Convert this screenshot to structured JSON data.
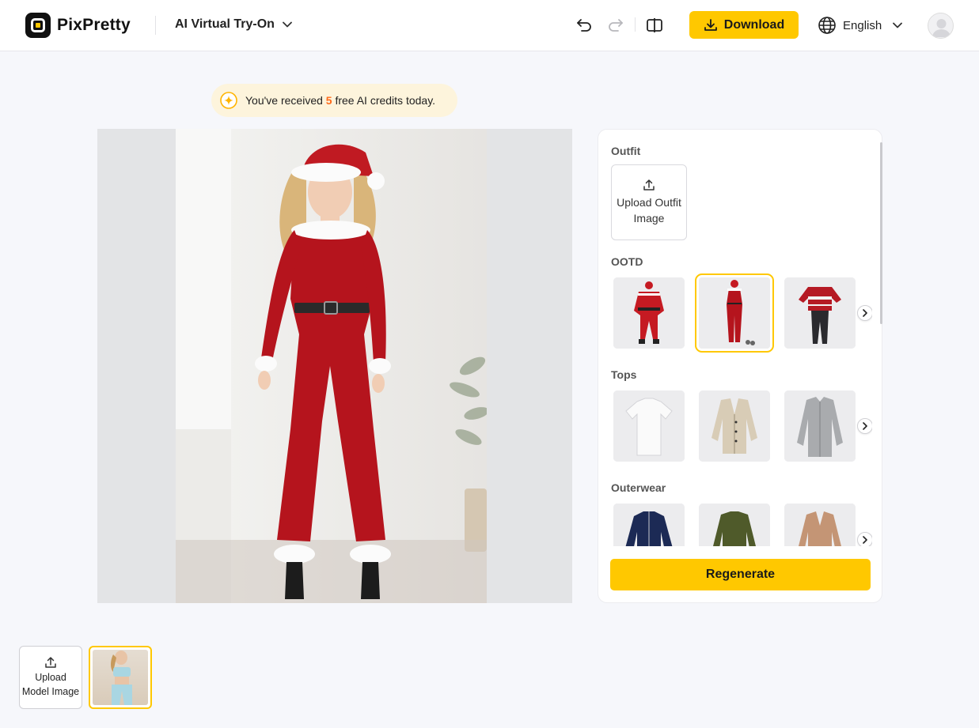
{
  "header": {
    "brand": "PixPretty",
    "tool_name": "AI Virtual Try-On",
    "download_label": "Download",
    "language": "English"
  },
  "banner": {
    "prefix": "You've received",
    "count": "5",
    "suffix": "free AI credits today."
  },
  "panel": {
    "outfit_title": "Outfit",
    "upload_outfit_label": "Upload Outfit Image",
    "sections": [
      {
        "title": "OOTD",
        "items": [
          "santa-suit",
          "red-jumpsuit",
          "christmas-sweater"
        ],
        "selected_index": 1
      },
      {
        "title": "Tops",
        "items": [
          "white-tshirt",
          "beige-cardigan",
          "grey-shirt"
        ]
      },
      {
        "title": "Outerwear",
        "items": [
          "navy-jacket",
          "olive-coat",
          "camel-blazer"
        ]
      }
    ],
    "regenerate_label": "Regenerate"
  },
  "bottom": {
    "upload_model_label": "Upload Model Image"
  },
  "colors": {
    "accent": "#ffc800",
    "highlight": "#ff6a1a",
    "banner_bg": "#fdf4dc"
  }
}
